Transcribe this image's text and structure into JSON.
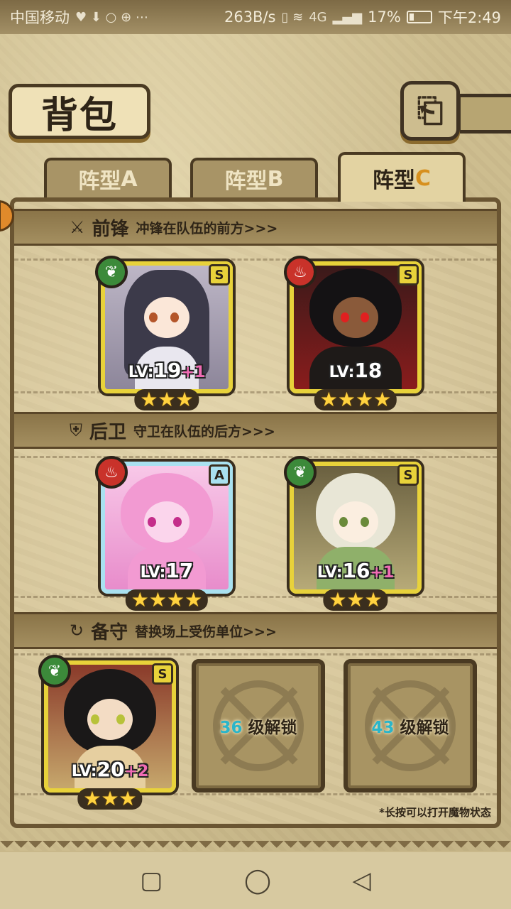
{
  "status_bar": {
    "carrier": "中国移动",
    "speed": "263B/s",
    "network": "4G",
    "battery": "17%",
    "time": "下午2:49"
  },
  "header": {
    "title": "背包",
    "back_icon": "back-arrow-icon"
  },
  "tabs": [
    {
      "label": "阵型",
      "suffix": "A",
      "active": false
    },
    {
      "label": "阵型",
      "suffix": "B",
      "active": false
    },
    {
      "label": "阵型",
      "suffix": "C",
      "active": true
    }
  ],
  "sections": {
    "front": {
      "title": "前锋",
      "desc": "冲锋在队伍的前方>>>",
      "icon": "sword-icon"
    },
    "rear": {
      "title": "后卫",
      "desc": "守卫在队伍的后方>>>",
      "icon": "shield-icon"
    },
    "reserve": {
      "title": "备守",
      "desc": "替换场上受伤单位>>>",
      "icon": "swap-icon"
    }
  },
  "units": {
    "front_1": {
      "element": "leaf",
      "rank": "S",
      "lv_prefix": "LV:",
      "lv": "19",
      "plus": "+1",
      "stars": "★★★"
    },
    "front_2": {
      "element": "fire",
      "rank": "S",
      "lv_prefix": "LV:",
      "lv": "18",
      "plus": "",
      "stars": "★★★★"
    },
    "rear_1": {
      "element": "fire",
      "rank": "A",
      "lv_prefix": "LV:",
      "lv": "17",
      "plus": "",
      "stars": "★★★★"
    },
    "rear_2": {
      "element": "leaf",
      "rank": "S",
      "lv_prefix": "LV:",
      "lv": "16",
      "plus": "+1",
      "stars": "★★★"
    },
    "reserve_1": {
      "element": "leaf",
      "rank": "S",
      "lv_prefix": "LV:",
      "lv": "20",
      "plus": "+2",
      "stars": "★★★"
    }
  },
  "locked_slots": [
    {
      "level": "36",
      "text": "级解锁"
    },
    {
      "level": "43",
      "text": "级解锁"
    }
  ],
  "hint": "*长按可以打开魔物状态",
  "colors": {
    "gold_frame": "#e8d23a",
    "silver_frame": "#a9e1f0",
    "leaf": "#3c8a3a",
    "fire": "#c9322a",
    "unlock_level": "#2bb5c9",
    "bonus_plus": "#f06bb4"
  }
}
